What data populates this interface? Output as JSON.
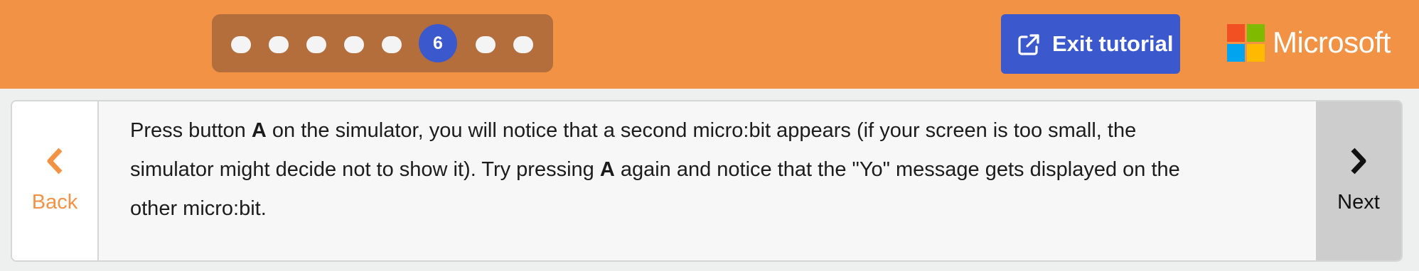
{
  "header": {
    "steps": {
      "total": 8,
      "current": 6,
      "current_label": "6"
    },
    "exit_label": "Exit tutorial",
    "exit_icon": "external-link-icon",
    "brand": "Microsoft",
    "brand_colors": [
      "#f25022",
      "#7fba00",
      "#00a4ef",
      "#ffb900"
    ]
  },
  "tutorial": {
    "text_parts": [
      "Press button ",
      "A",
      " on the simulator, you will notice that a second micro:bit appears (if your screen is too small, the simulator might decide not to show it). Try pressing ",
      "A",
      " again and notice that the \"Yo\" message gets displayed on the other micro:bit."
    ],
    "back_label": "Back",
    "back_icon": "chevron-left-icon",
    "next_label": "Next",
    "next_icon": "chevron-right-icon"
  },
  "colors": {
    "header_bg": "#f29245",
    "accent_blue": "#3c58cd",
    "back_orange": "#f29245"
  }
}
